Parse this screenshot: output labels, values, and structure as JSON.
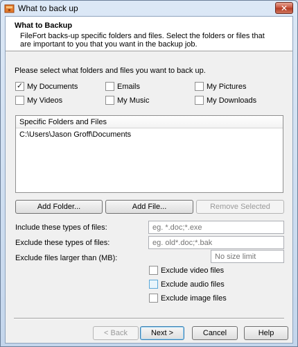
{
  "window": {
    "title": "What to back up",
    "close_glyph": "✕"
  },
  "header": {
    "title": "What to Backup",
    "description": "FileFort backs-up specific folders and files. Select the folders or files that are important to you that you want in the backup job."
  },
  "prompt": "Please select what folders and files you want to back up.",
  "folders": {
    "my_documents": {
      "label": "My Documents",
      "checked": true
    },
    "emails": {
      "label": "Emails",
      "checked": false
    },
    "my_pictures": {
      "label": "My Pictures",
      "checked": false
    },
    "my_videos": {
      "label": "My Videos",
      "checked": false
    },
    "my_music": {
      "label": "My Music",
      "checked": false
    },
    "my_downloads": {
      "label": "My Downloads",
      "checked": false
    },
    "check_glyph": "✓"
  },
  "specific": {
    "header": "Specific Folders and Files",
    "items": [
      "C:\\Users\\Jason Groff\\Documents"
    ]
  },
  "list_buttons": {
    "add_folder": "Add Folder...",
    "add_file": "Add File...",
    "remove_selected": "Remove Selected"
  },
  "filters": {
    "include_label": "Include these types of files:",
    "include_placeholder": "eg. *.doc;*.exe",
    "exclude_label": "Exclude these types of files:",
    "exclude_placeholder": "eg. old*.doc;*.bak",
    "size_label": "Exclude files larger than (MB):",
    "size_placeholder": "No size limit"
  },
  "excludes": {
    "video": {
      "label": "Exclude video files",
      "checked": false
    },
    "audio": {
      "label": "Exclude audio files",
      "checked": false
    },
    "image": {
      "label": "Exclude image files",
      "checked": false
    }
  },
  "nav": {
    "back": "< Back",
    "next": "Next >",
    "cancel": "Cancel",
    "help": "Help"
  },
  "colors": {
    "title_bar": "#c4d6ec",
    "close_button": "#c7503a",
    "accent_border": "#3c7fb1"
  }
}
